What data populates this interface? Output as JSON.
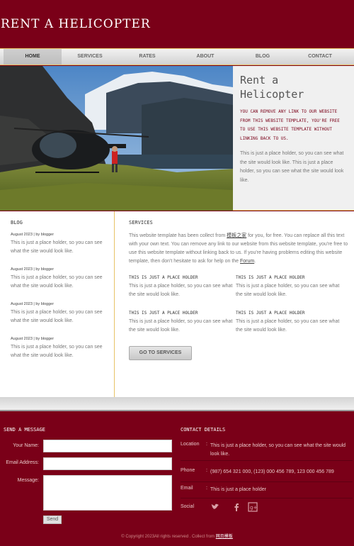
{
  "header": {
    "logo": "RENT A HELICOPTER"
  },
  "nav": {
    "items": [
      {
        "label": "Home",
        "active": true
      },
      {
        "label": "Services",
        "active": false
      },
      {
        "label": "Rates",
        "active": false
      },
      {
        "label": "About",
        "active": false
      },
      {
        "label": "Blog",
        "active": false
      },
      {
        "label": "Contact",
        "active": false
      }
    ]
  },
  "hero": {
    "title_line1": "Rent a",
    "title_line2": "Helicopter",
    "strong": "You can remove any link to our website from this website template, you're free to use this website template without linking back to us.",
    "text": "This is just a place holder, so you can see what the site would look like. This is just a place holder, so you can see what the site would look like."
  },
  "blog": {
    "title": "Blog",
    "items": [
      {
        "meta": "August 2023 | by blogger",
        "text": "This is just a place holder, so you can see what the site would look like."
      },
      {
        "meta": "August 2023 | by blogger",
        "text": "This is just a place holder, so you can see what the site would look like."
      },
      {
        "meta": "August 2023 | by blogger",
        "text": "This is just a place holder, so you can see what the site would look like."
      },
      {
        "meta": "August 2023 | by blogger",
        "text": "This is just a place holder, so you can see what the site would look like."
      }
    ]
  },
  "services": {
    "title": "Services",
    "intro_1": "This website template has been collect from ",
    "intro_link1": "模板之家",
    "intro_2": " for you, for free. You can replace all this text with your own text. You can remove any link to our website from this website template, you're free to use this website template without linking back to us. If you're having problems editing this website template, then don't hesitate to ask for help on the ",
    "intro_link2": "Forum",
    "intro_3": ".",
    "boxes": [
      {
        "title": "This is just a place holder",
        "text": "This is just a place holder, so you can see what the site would look like."
      },
      {
        "title": "This is just a place holder",
        "text": "This is just a place holder, so you can see what the site would look like."
      },
      {
        "title": "This is just a place holder",
        "text": "This is just a place holder, so you can see what the site would look like."
      },
      {
        "title": "This is just a place holder",
        "text": "This is just a place holder, so you can see what the site would look like."
      }
    ],
    "button": "Go to services"
  },
  "send_message": {
    "title": "Send a message",
    "name_label": "Your Name:",
    "email_label": "Email Address:",
    "message_label": "Message:",
    "send_label": "Send"
  },
  "contact": {
    "title": "Contact details",
    "rows": [
      {
        "label": "Location",
        "value": "This is just a place holder, so you can see what the site would look like."
      },
      {
        "label": "Phone",
        "value": "(987) 654 321 000, (123) 000 456 789, 123 000 456 789"
      },
      {
        "label": "Email",
        "value": "This is just a place holder"
      },
      {
        "label": "Social",
        "value": ""
      }
    ],
    "social_icons": [
      "twitter-icon",
      "facebook-icon",
      "googleplus-icon"
    ]
  },
  "footer": {
    "copyright": "© Copyright 2023All rights reserved . Collect from ",
    "copyright_link": "网页模板"
  },
  "colors": {
    "primary": "#7a0018",
    "accent_border": "#e8c266",
    "light_bg": "#f0f0f0"
  }
}
